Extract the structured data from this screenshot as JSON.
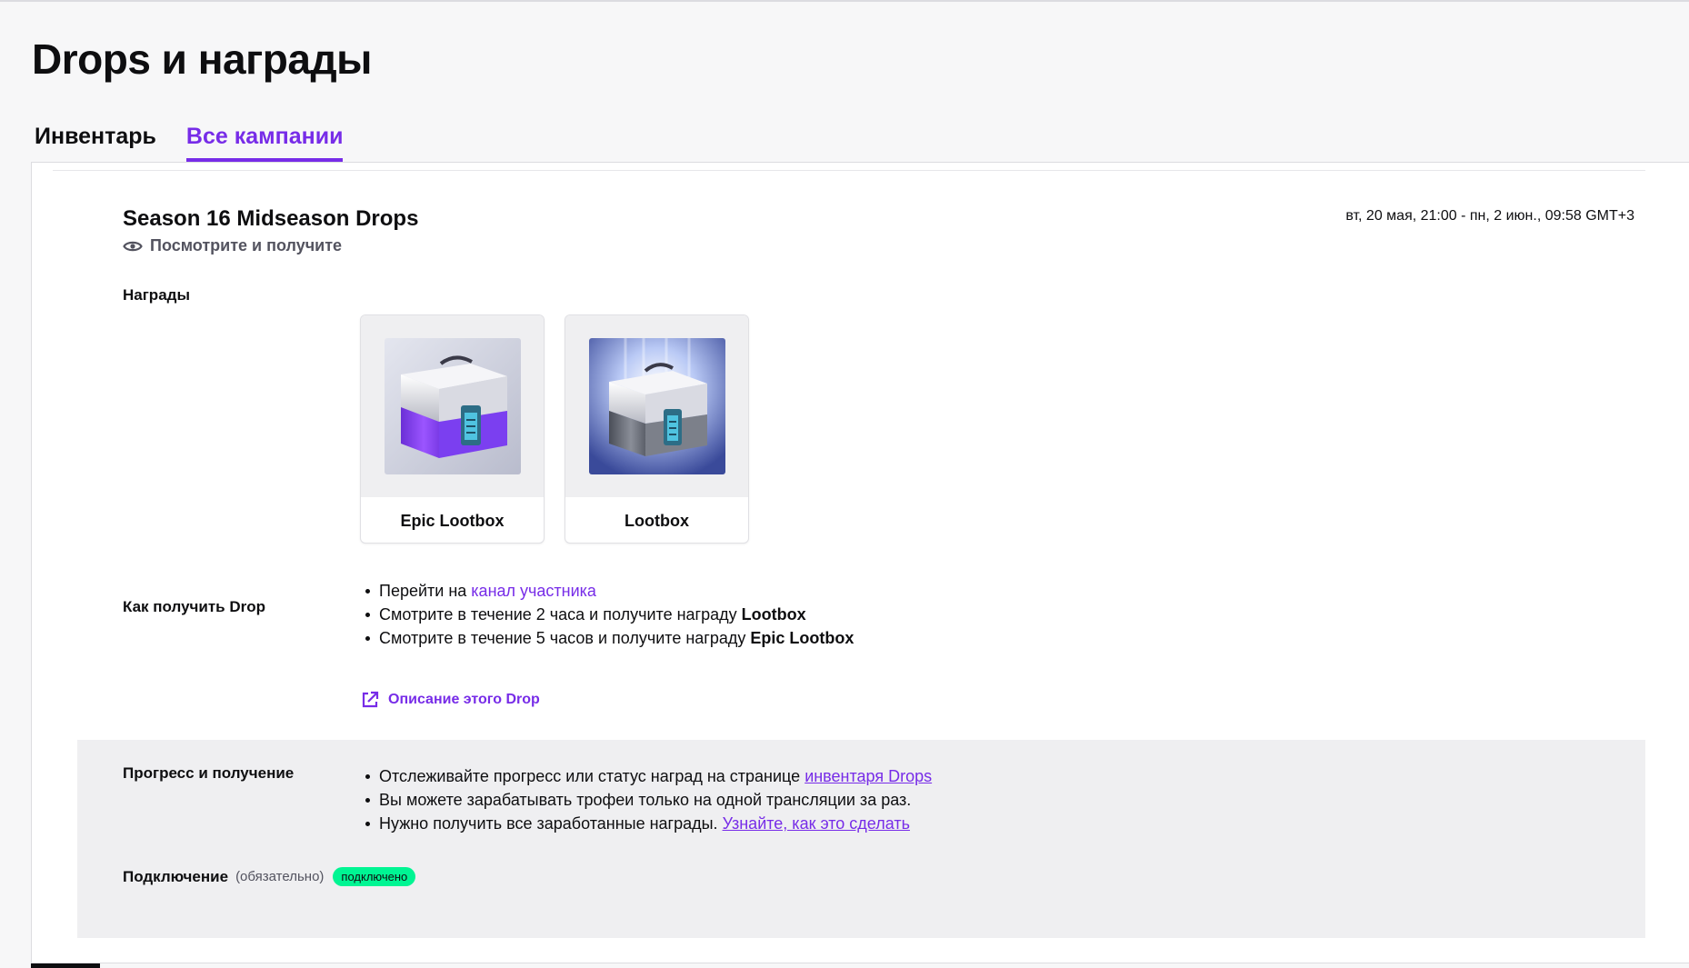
{
  "page": {
    "title": "Drops и награды"
  },
  "tabs": [
    {
      "label": "Инвентарь",
      "active": false
    },
    {
      "label": "Все кампании",
      "active": true
    }
  ],
  "campaign": {
    "title": "Season 16 Midseason Drops",
    "subtitle": "Посмотрите и получите",
    "subtitle_icon": "eye-icon",
    "dates": "вт, 20 мая, 21:00 - пн, 2 июн., 09:58 GMT+3",
    "rewards_label": "Награды",
    "rewards": [
      {
        "name": "Epic Lootbox",
        "icon": "epic-lootbox-image"
      },
      {
        "name": "Lootbox",
        "icon": "lootbox-image"
      }
    ],
    "howto_label": "Как получить Drop",
    "howto": {
      "item1_prefix": "Перейти на ",
      "item1_link": "канал участника",
      "item2_prefix": "Смотрите в течение 2 часа и получите награду ",
      "item2_bold": "Lootbox",
      "item3_prefix": "Смотрите в течение 5 часов и получите награду ",
      "item3_bold": "Epic Lootbox"
    },
    "description_link": "Описание этого Drop",
    "description_icon": "external-link-icon"
  },
  "progress": {
    "label": "Прогресс и получение",
    "item1_prefix": "Отслеживайте прогресс или статус наград на странице ",
    "item1_link": "инвентаря Drops",
    "item2": "Вы можете зарабатывать трофеи только на одной трансляции за раз.",
    "item3_prefix": "Нужно получить все заработанные награды. ",
    "item3_link": "Узнайте, как это сделать"
  },
  "connection": {
    "label": "Подключение",
    "optional": "(обязательно)",
    "status": "подключено"
  },
  "colors": {
    "accent": "#772ce8",
    "connected": "#00f593"
  }
}
